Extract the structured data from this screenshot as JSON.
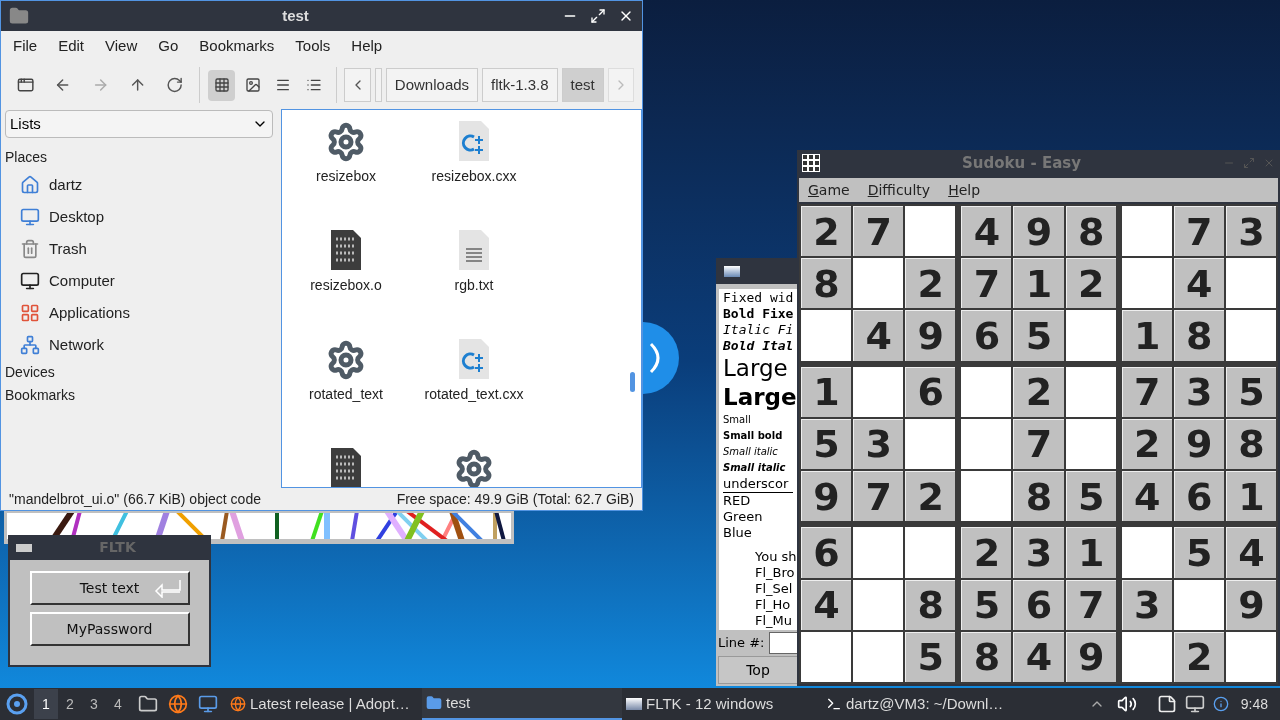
{
  "file_manager": {
    "title": "test",
    "menu": [
      "File",
      "Edit",
      "View",
      "Go",
      "Bookmarks",
      "Tools",
      "Help"
    ],
    "view_modes": [
      {
        "kind": "icons",
        "selected": true
      },
      {
        "kind": "thumbnails",
        "selected": false
      },
      {
        "kind": "compact",
        "selected": false
      },
      {
        "kind": "details",
        "selected": false
      }
    ],
    "path": [
      {
        "label": "Downloads",
        "selected": false
      },
      {
        "label": "fltk-1.3.8",
        "selected": false
      },
      {
        "label": "test",
        "selected": true
      }
    ],
    "side_pane_mode": "Lists",
    "sidebar": [
      {
        "kind": "header",
        "label": "Places"
      },
      {
        "kind": "home",
        "label": "dartz"
      },
      {
        "kind": "desktop",
        "label": "Desktop"
      },
      {
        "kind": "trash",
        "label": "Trash"
      },
      {
        "kind": "computer",
        "label": "Computer"
      },
      {
        "kind": "applications",
        "label": "Applications"
      },
      {
        "kind": "network",
        "label": "Network"
      },
      {
        "kind": "header",
        "label": "Devices"
      },
      {
        "kind": "header",
        "label": "Bookmarks"
      }
    ],
    "files": [
      {
        "kind": "executable",
        "name": "resizebox"
      },
      {
        "kind": "cxx",
        "name": "resizebox.cxx"
      },
      {
        "kind": "object",
        "name": "resizebox.o"
      },
      {
        "kind": "text",
        "name": "rgb.txt"
      },
      {
        "kind": "executable",
        "name": "rotated_text"
      },
      {
        "kind": "cxx",
        "name": "rotated_text.cxx"
      },
      {
        "kind": "object"
      },
      {
        "kind": "executable"
      }
    ],
    "status_left": "\"mandelbrot_ui.o\" (66.7 KiB) object code",
    "status_right": "Free space: 49.9 GiB (Total: 62.7 GiB)"
  },
  "fltk_window": {
    "title": "FLTK",
    "buttons": [
      {
        "label": "Test text",
        "kind": "return"
      },
      {
        "label": "MyPassword",
        "kind": "plain"
      }
    ]
  },
  "browser_window": {
    "lines": [
      {
        "kind": "fixed",
        "text": "Fixed wid"
      },
      {
        "kind": "fixed-bold",
        "text": "Bold Fixe"
      },
      {
        "kind": "fixed-italic",
        "text": "Italic Fi"
      },
      {
        "kind": "fixed-bold-italic",
        "text": "Bold Ital"
      },
      {
        "kind": "large",
        "text": "Large"
      },
      {
        "kind": "large-bold",
        "text": "Large"
      },
      {
        "kind": "small",
        "text": "Small"
      },
      {
        "kind": "small-bold",
        "text": "Small bold"
      },
      {
        "kind": "small-italic",
        "text": "Small italic"
      },
      {
        "kind": "small-bold-italic",
        "text": "Small italic"
      },
      {
        "kind": "underscore",
        "text": "underscor"
      },
      {
        "kind": "red",
        "text": "RED"
      },
      {
        "kind": "green",
        "text": "Green"
      },
      {
        "kind": "blue",
        "text": "Blue"
      },
      {
        "kind": "blank"
      },
      {
        "kind": "indented",
        "text": "You sh"
      },
      {
        "kind": "indented",
        "text": "Fl_Bro"
      },
      {
        "kind": "indented",
        "text": "Fl_Sel"
      },
      {
        "kind": "indented",
        "text": "Fl_Ho"
      },
      {
        "kind": "indented",
        "text": "Fl_Mu"
      }
    ],
    "line_label": "Line #:",
    "top_button": "Top"
  },
  "sudoku": {
    "title": "Sudoku - Easy",
    "menu": [
      "Game",
      "Difficulty",
      "Help"
    ],
    "rows": [
      [
        "2",
        "7",
        "",
        "4",
        "9",
        "8",
        "",
        "7",
        "3"
      ],
      [
        "8",
        "",
        "2",
        "7",
        "1",
        "2",
        "",
        "4",
        ""
      ],
      [
        "",
        "4",
        "9",
        "6",
        "5",
        "",
        "1",
        "8",
        ""
      ],
      [
        "1",
        "",
        "6",
        "",
        "2",
        "",
        "7",
        "3",
        "5"
      ],
      [
        "5",
        "3",
        "",
        "",
        "7",
        "",
        "2",
        "9",
        "8"
      ],
      [
        "9",
        "7",
        "2",
        "",
        "8",
        "5",
        "4",
        "6",
        "1"
      ],
      [
        "6",
        "",
        "",
        "2",
        "3",
        "1",
        "",
        "5",
        "4"
      ],
      [
        "4",
        "",
        "8",
        "5",
        "6",
        "7",
        "3",
        "",
        "9"
      ],
      [
        "",
        "",
        "5",
        "8",
        "4",
        "9",
        "",
        "2",
        ""
      ]
    ]
  },
  "taskbar": {
    "workspaces": [
      {
        "label": "1",
        "selected": true
      },
      {
        "label": "2",
        "selected": false
      },
      {
        "label": "3",
        "selected": false
      },
      {
        "label": "4",
        "selected": false
      }
    ],
    "tasks": [
      {
        "kind": "browser",
        "label": "Latest release | Adopt…",
        "selected": false
      },
      {
        "kind": "folder",
        "label": "test",
        "selected": true
      },
      {
        "kind": "window",
        "label": "FLTK - 12 windows",
        "selected": false
      },
      {
        "kind": "terminal",
        "label": "dartz@VM3: ~/Downl…",
        "selected": false
      }
    ],
    "clock": "9:48"
  }
}
